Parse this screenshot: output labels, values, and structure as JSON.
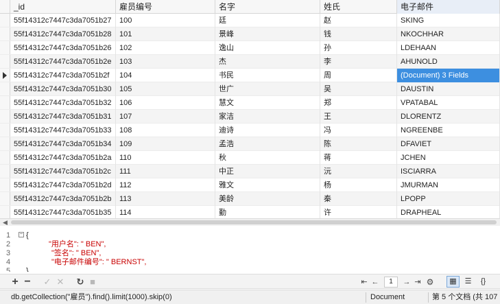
{
  "grid": {
    "columns": [
      "_id",
      "雇员编号",
      "名字",
      "姓氏",
      "电子邮件"
    ],
    "rows": [
      [
        "55f14312c7447c3da7051b27",
        "100",
        "廷",
        "赵",
        "SKING"
      ],
      [
        "55f14312c7447c3da7051b28",
        "101",
        "景峰",
        "钱",
        "NKOCHHAR"
      ],
      [
        "55f14312c7447c3da7051b26",
        "102",
        "逸山",
        "孙",
        "LDEHAAN"
      ],
      [
        "55f14312c7447c3da7051b2e",
        "103",
        "杰",
        "李",
        "AHUNOLD"
      ],
      [
        "55f14312c7447c3da7051b2f",
        "104",
        "书民",
        "周",
        "(Document) 3 Fields"
      ],
      [
        "55f14312c7447c3da7051b30",
        "105",
        "世广",
        "吴",
        "DAUSTIN"
      ],
      [
        "55f14312c7447c3da7051b32",
        "106",
        "慧文",
        "郑",
        "VPATABAL"
      ],
      [
        "55f14312c7447c3da7051b31",
        "107",
        "家洁",
        "王",
        "DLORENTZ"
      ],
      [
        "55f14312c7447c3da7051b33",
        "108",
        "迪诗",
        "冯",
        "NGREENBE"
      ],
      [
        "55f14312c7447c3da7051b34",
        "109",
        "孟浩",
        "陈",
        "DFAVIET"
      ],
      [
        "55f14312c7447c3da7051b2a",
        "110",
        "秋",
        "蒋",
        "JCHEN"
      ],
      [
        "55f14312c7447c3da7051b2c",
        "111",
        "中正",
        "沅",
        "ISCIARRA"
      ],
      [
        "55f14312c7447c3da7051b2d",
        "112",
        "雅文",
        "杨",
        "JMURMAN"
      ],
      [
        "55f14312c7447c3da7051b2b",
        "113",
        "美龄",
        "秦",
        "LPOPP"
      ],
      [
        "55f14312c7447c3da7051b35",
        "114",
        "勤",
        "许",
        "DRAPHEAL"
      ]
    ],
    "selected_row": 4,
    "selected_column": 4
  },
  "code": {
    "lines": [
      {
        "no": "1",
        "text": "{"
      },
      {
        "no": "2",
        "text": "\"用户名\": \" BEN\","
      },
      {
        "no": "3",
        "text": "\"签名\": \" BEN\","
      },
      {
        "no": "4",
        "text": "\"电子邮件编号\": \" BERNST\","
      },
      {
        "no": "5",
        "text": "}"
      }
    ]
  },
  "toolbar": {
    "add_icon": "plus-icon",
    "remove_icon": "minus-icon",
    "apply_icon": "check-icon",
    "discard_icon": "cross-icon",
    "refresh_icon": "refresh-icon",
    "stop_icon": "stop-icon",
    "page": "1",
    "views": [
      "grid-view-icon",
      "form-view-icon",
      "json-view-icon"
    ],
    "active_view": "grid-view-icon"
  },
  "status": {
    "query": "db.getCollection(\"雇员\").find().limit(1000).skip(0)",
    "mode": "Document",
    "record_info": "第 5 个文档 (共 107"
  }
}
